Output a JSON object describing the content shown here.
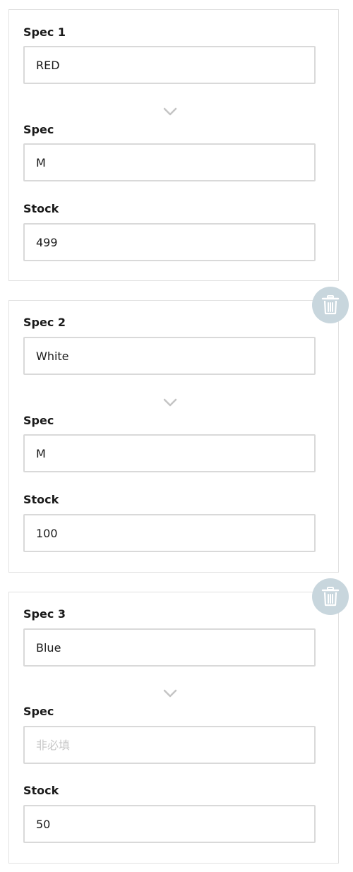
{
  "specs": [
    {
      "title": "Spec 1",
      "value": "RED",
      "sub_label": "Spec",
      "sub_value": "M",
      "sub_placeholder": "",
      "stock_label": "Stock",
      "stock_value": "499"
    },
    {
      "title": "Spec 2",
      "value": "White",
      "sub_label": "Spec",
      "sub_value": "M",
      "sub_placeholder": "",
      "stock_label": "Stock",
      "stock_value": "100"
    },
    {
      "title": "Spec 3",
      "value": "Blue",
      "sub_label": "Spec",
      "sub_value": "",
      "sub_placeholder": "非必填",
      "stock_label": "Stock",
      "stock_value": "50"
    }
  ],
  "icons": {
    "expand": "chevron-down-icon",
    "delete": "trash-icon"
  },
  "colors": {
    "delete_button_bg": "#c8d6dd",
    "border": "#d9d9d9",
    "placeholder": "#c8c8c8"
  }
}
